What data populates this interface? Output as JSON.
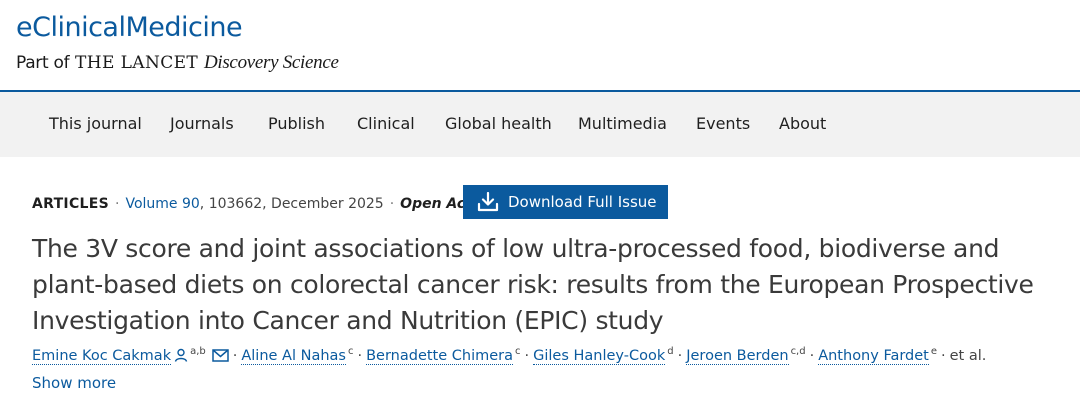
{
  "header": {
    "journal_name": "eClinicalMedicine",
    "tagline_prefix": "Part of",
    "tagline_brand": "THE LANCET",
    "tagline_suffix": "Discovery Science"
  },
  "nav": {
    "items": [
      {
        "label": "This journal"
      },
      {
        "label": "Journals"
      },
      {
        "label": "Publish"
      },
      {
        "label": "Clinical"
      },
      {
        "label": "Global health"
      },
      {
        "label": "Multimedia"
      },
      {
        "label": "Events"
      },
      {
        "label": "About"
      }
    ]
  },
  "article": {
    "type": "ARTICLES",
    "volume": "Volume 90",
    "citation_rest": ", 103662, December 2025",
    "access": "Open Access",
    "download_label": "Download Full Issue",
    "title": "The 3V score and joint associations of low ultra-processed food, biodiverse and plant-based diets on colorectal cancer risk: results from the European Prospective Investigation into Cancer and Nutrition (EPIC) study",
    "authors": [
      {
        "name": "Emine Koc Cakmak",
        "aff": "a,b"
      },
      {
        "name": "Aline Al Nahas",
        "aff": "c"
      },
      {
        "name": "Bernadette Chimera",
        "aff": "c"
      },
      {
        "name": "Giles Hanley-Cook",
        "aff": "d"
      },
      {
        "name": "Jeroen Berden",
        "aff": "c,d"
      },
      {
        "name": "Anthony Fardet",
        "aff": "e"
      }
    ],
    "et_al": "et al.",
    "show_more": "Show more"
  },
  "colors": {
    "brand_blue": "#0b5a9e",
    "nav_background": "#f2f2f2"
  }
}
